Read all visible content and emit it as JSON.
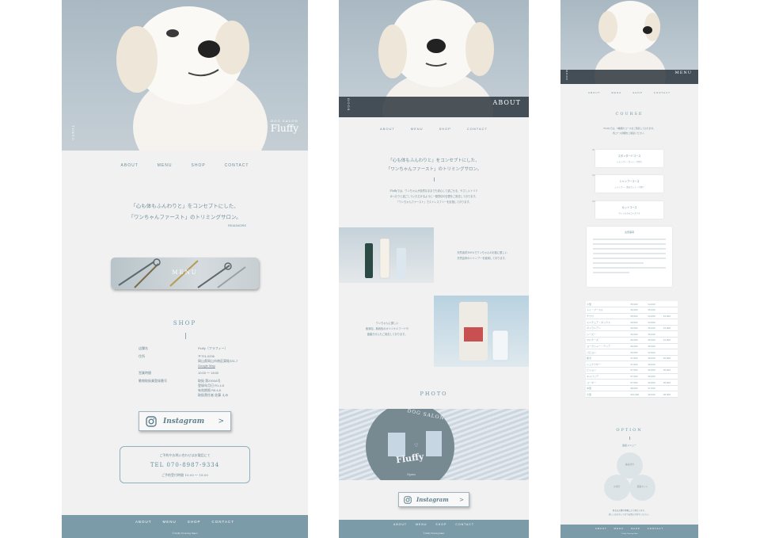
{
  "colors": {
    "accent": "#6a97a5",
    "footer": "#7c9ba8",
    "background": "#f1f1f1"
  },
  "nav": {
    "about": "ABOUT",
    "menu": "MENU",
    "shop": "SHOP",
    "contact": "CONTACT"
  },
  "page1": {
    "hero_vertical": "TOKYO",
    "brand_small": "DOG SALON",
    "brand_name": "Fluffy",
    "tagline_line1": "「心も体もふんわりと」をコンセプトにした、",
    "tagline_line2": "「ワンちゃんファースト」のトリミングサロン。",
    "readmore": "READMORE",
    "menu_banner": "MENU",
    "shop_title": "SHOP",
    "shop_rows": [
      {
        "label": "店舗名",
        "value": "Fluffy（フラフィー）"
      },
      {
        "label": "住所",
        "value": "〒701-0206"
      },
      {
        "label": "",
        "value": "岡山県岡山市南区東畦331-7"
      },
      {
        "label": "",
        "value": "Google Map"
      },
      {
        "label": "営業時間",
        "value": "10:00 〜 18:00"
      },
      {
        "label": "動物取扱業登録番号",
        "value": "取扱 第2000A号"
      },
      {
        "label": "",
        "value": "登録年月日 R1.4.8"
      },
      {
        "label": "",
        "value": "有効期限 R6.4.8"
      },
      {
        "label": "",
        "value": "取扱責任者 佐藤 えみ"
      }
    ],
    "instagram": "Instagram",
    "arrow": ">",
    "contact_note": "ご予約やお問い合わせはお電話にて",
    "tel": "TEL 070-8987-9334",
    "reception": "ご予約受付時間 10:00 〜 18:00",
    "copyright": "© Fluffy Trimming Salon"
  },
  "page2": {
    "hero_vertical": "DOGS",
    "hero_title": "ABOUT",
    "tagline_line1": "「心も体もふんわりと」をコンセプトにした、",
    "tagline_line2": "「ワンちゃんファースト」のトリミングサロン。",
    "body_line1": "Fluffyでは、ワンちゃんが自然なままでも安心して過ごせる、やさしいトリミ",
    "body_line2": "ゆったりと過ごしていただけるように一頭貸切の空間をご用意しております。",
    "body_line3": "「ワンちゃんファースト」でストレスフリーを目指しております。",
    "product1_text1": "天然素材100%でワンちゃんのお肌に優しい",
    "product1_text2": "天然由来のシャンプーを使用しております。",
    "product2_text1": "ワンちゃんに優しい",
    "product2_text2": "無添加、無着色のオリジナルフードや",
    "product2_text3": "歯磨きガムもご用意しております。",
    "photo_title": "PHOTO",
    "sign_top": "DOG SALON",
    "sign_name": "Fluffy",
    "sign_open": "Open",
    "instagram": "Instagram",
    "arrow": ">",
    "copyright": "© Fluffy Trimming Salon"
  },
  "page3": {
    "hero_vertical": "MENU",
    "hero_title": "MENU",
    "course_title": "COURSE",
    "course_intro1": "Fluffyでは、3種類のコースをご用意しております。",
    "course_intro2": "各コース詳細をご確認ください。",
    "courses": [
      {
        "num": "01",
        "name": "スタンダードコース",
        "desc": "シャンプー・カット・爪切り"
      },
      {
        "num": "02",
        "name": "シャンプーコース",
        "desc": "シャンプー・部分カット・爪切り"
      },
      {
        "num": "03",
        "name": "カットコース",
        "desc": "カットのみのコースです"
      }
    ],
    "notes_title": "注意事項",
    "table_rows": [
      {
        "breed": "小型",
        "a": "¥5,000",
        "b": "¥4,000",
        "c": ""
      },
      {
        "breed": "トイ・プードル",
        "a": "¥6,000",
        "b": "¥5,000",
        "c": ""
      },
      {
        "breed": "チワワ",
        "a": "¥5,000",
        "b": "¥4,000",
        "c": "¥3,000"
      },
      {
        "breed": "ミニチュア・ダックス",
        "a": "¥5,500",
        "b": "¥4,500",
        "c": ""
      },
      {
        "breed": "ポメラニアン",
        "a": "¥6,000",
        "b": "¥5,000",
        "c": "¥4,000"
      },
      {
        "breed": "シーズー",
        "a": "¥6,000",
        "b": "¥5,000",
        "c": ""
      },
      {
        "breed": "マルチーズ",
        "a": "¥6,000",
        "b": "¥5,000",
        "c": "¥4,000"
      },
      {
        "breed": "ヨークシャー・テリア",
        "a": "¥6,000",
        "b": "¥5,000",
        "c": ""
      },
      {
        "breed": "パピヨン",
        "a": "¥5,500",
        "b": "¥4,500",
        "c": ""
      },
      {
        "breed": "柴犬",
        "a": "¥7,000",
        "b": "¥6,000",
        "c": "¥5,000"
      },
      {
        "breed": "シュナウザー",
        "a": "¥7,000",
        "b": "¥6,000",
        "c": ""
      },
      {
        "breed": "ビション",
        "a": "¥7,500",
        "b": "¥6,500",
        "c": "¥5,500"
      },
      {
        "breed": "キャバリア",
        "a": "¥7,000",
        "b": "¥6,000",
        "c": ""
      },
      {
        "breed": "コーギー",
        "a": "¥7,500",
        "b": "¥6,500",
        "c": "¥5,500"
      },
      {
        "breed": "中型",
        "a": "¥8,000",
        "b": "¥7,000",
        "c": ""
      },
      {
        "breed": "大型",
        "a": "¥10,000",
        "b": "¥9,000",
        "c": "¥8,000"
      }
    ],
    "option_title": "OPTION",
    "option_sub": "追加メニュー",
    "options": [
      "歯みがき",
      "爪切り",
      "足裏カット"
    ],
    "option_note1": "料金は犬種や体重により異なります。",
    "option_note2": "詳しくはスタッフまでお問い合わせください。",
    "copyright": "© Fluffy Trimming Salon"
  }
}
